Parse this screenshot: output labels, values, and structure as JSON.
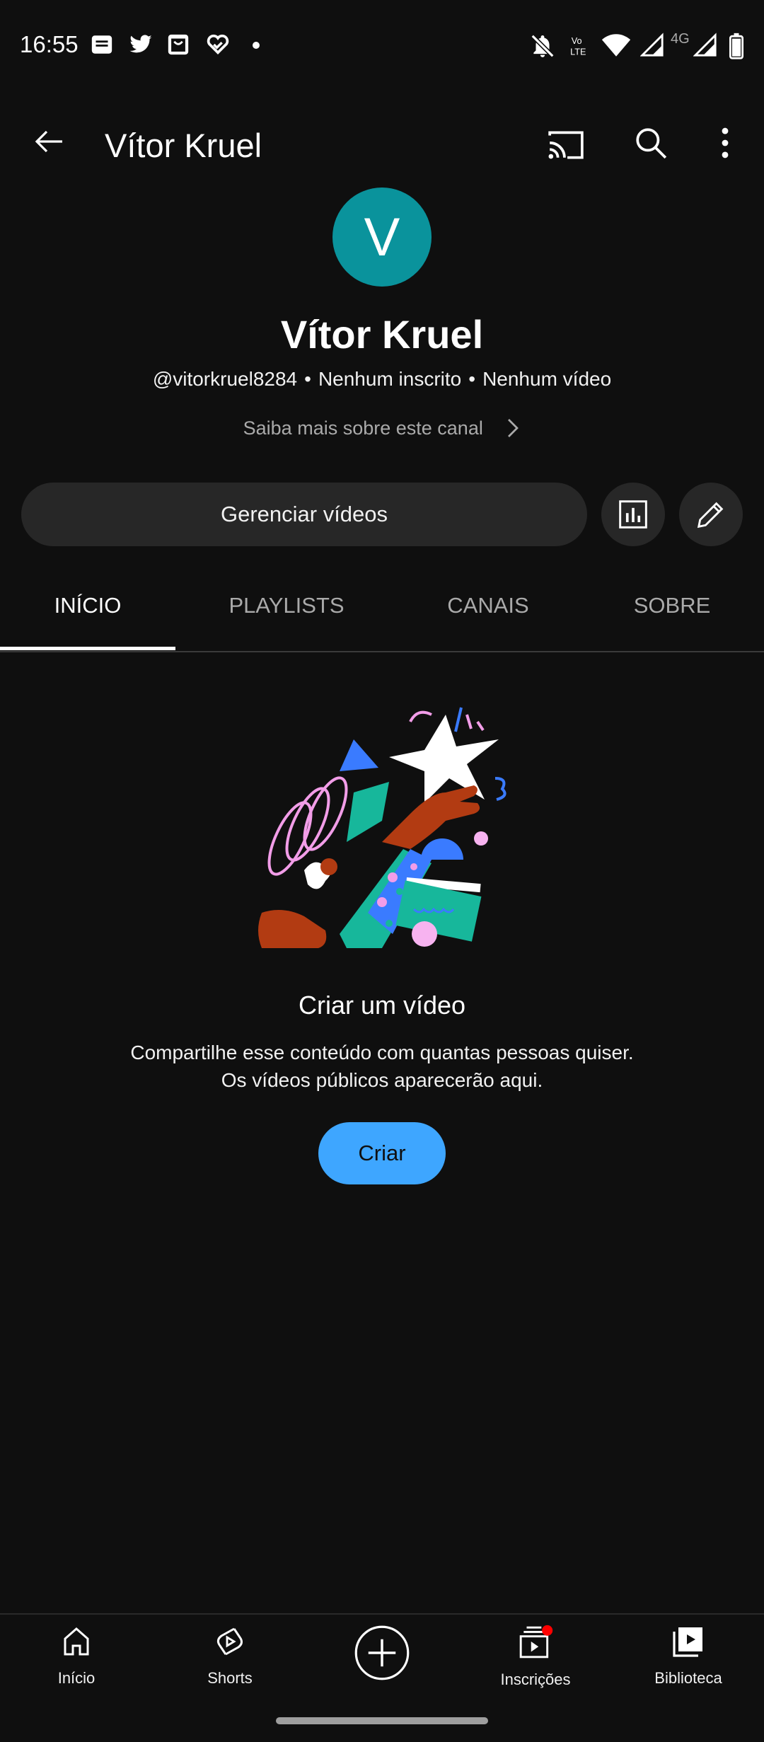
{
  "status_bar": {
    "time": "16:55",
    "network_label": "4G"
  },
  "top_bar": {
    "title": "Vítor Kruel"
  },
  "channel": {
    "avatar_letter": "V",
    "avatar_color": "#0a939c",
    "name": "Vítor Kruel",
    "handle": "@vitorkruel8284",
    "subscribers": "Nenhum inscrito",
    "videos": "Nenhum vídeo",
    "learn_more": "Saiba mais sobre este canal",
    "manage_label": "Gerenciar vídeos"
  },
  "tabs": [
    {
      "label": "INÍCIO",
      "active": true
    },
    {
      "label": "PLAYLISTS",
      "active": false
    },
    {
      "label": "CANAIS",
      "active": false
    },
    {
      "label": "SOBRE",
      "active": false
    }
  ],
  "empty_state": {
    "title": "Criar um vídeo",
    "line1": "Compartilhe esse conteúdo com quantas pessoas quiser.",
    "line2": "Os vídeos públicos aparecerão aqui.",
    "button_label": "Criar",
    "button_color": "#3ea6ff"
  },
  "bottom_nav": {
    "home": "Início",
    "shorts": "Shorts",
    "subscriptions": "Inscrições",
    "library": "Biblioteca",
    "notification_dot_color": "#ff0000"
  }
}
